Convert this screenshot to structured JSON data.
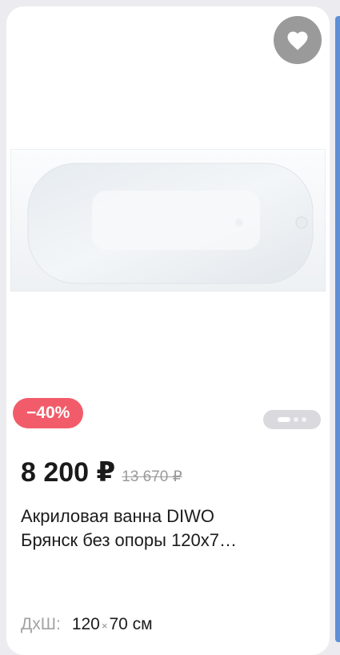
{
  "product": {
    "discount": "−40%",
    "price": "8 200 ₽",
    "old_price": "13 670 ₽",
    "title_line1": "Акриловая ванна DIWO",
    "title_line2": "Брянск без опоры 120х7…",
    "dims_label": "ДхШ:",
    "dims_width": "120",
    "dims_x": "×",
    "dims_height": "70 см",
    "image": "bathtub-image",
    "favorite_icon": "heart-icon"
  },
  "colors": {
    "badge": "#f25c6a",
    "favorite_bg": "#9a9a9a",
    "accent_strip": "#5f8fd6"
  }
}
